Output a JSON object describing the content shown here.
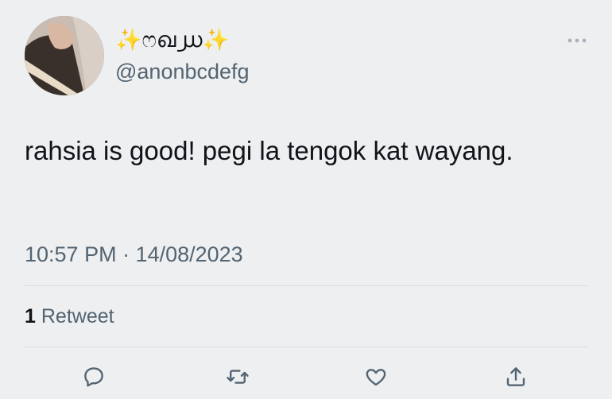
{
  "author": {
    "display_name_sparkle_left": "✨",
    "display_name_text": "ෆഖ൰",
    "display_name_sparkle_right": "✨",
    "handle": "@anonbcdefg"
  },
  "tweet": {
    "text": "rahsia is good! pegi la tengok kat wayang.",
    "timestamp": "10:57 PM · 14/08/2023"
  },
  "stats": {
    "retweet_count": "1",
    "retweet_label": "Retweet"
  },
  "actions": [
    {
      "icon": "reply-icon"
    },
    {
      "icon": "retweet-icon"
    },
    {
      "icon": "like-icon"
    },
    {
      "icon": "share-icon"
    }
  ],
  "colors": {
    "background": "#eeeff1",
    "primary_text": "#0f1419",
    "secondary_text": "#536471",
    "divider": "#d9dde1",
    "sparkle": "#f2c200"
  }
}
